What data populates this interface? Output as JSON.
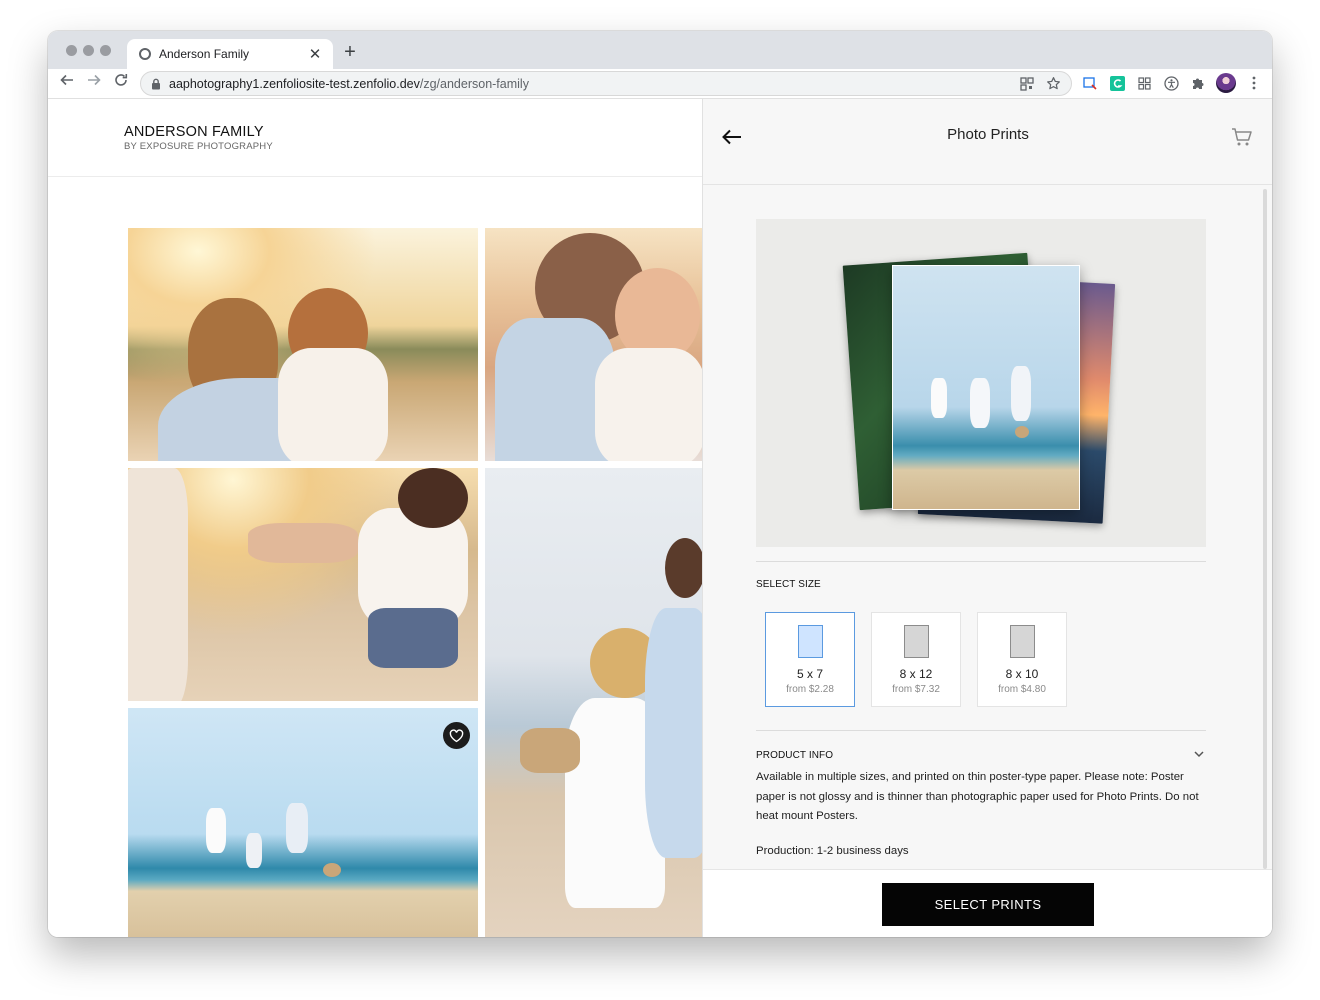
{
  "browser": {
    "tab_title": "Anderson Family",
    "url_host": "aaphotography1.zenfoliosite-test.zenfolio.dev",
    "url_path": "/zg/anderson-family",
    "icons": [
      "lock-icon",
      "qr-code-icon",
      "bookmark-star-icon",
      "reading-list-icon",
      "grammarly-icon",
      "extension-grid-icon",
      "accessibility-icon",
      "puzzle-icon",
      "profile-avatar",
      "kebab-menu-icon"
    ]
  },
  "site": {
    "title": "ANDERSON FAMILY",
    "subtitle": "BY EXPOSURE PHOTOGRAPHY"
  },
  "gallery": {
    "photos": [
      {
        "name": "photo-father-daughter-sunset"
      },
      {
        "name": "photo-father-kissing-daughter"
      },
      {
        "name": "photo-holding-hands-beach"
      },
      {
        "name": "photo-family-smiling-beach"
      },
      {
        "name": "photo-family-walking-shore",
        "favorite_icon": "heart-icon"
      }
    ]
  },
  "panel": {
    "title": "Photo Prints",
    "select_size_label": "SELECT SIZE",
    "sizes": [
      {
        "name": "5 x 7",
        "price": "from $2.28",
        "selected": true
      },
      {
        "name": "8 x 12",
        "price": "from $7.32",
        "selected": false
      },
      {
        "name": "8 x 10",
        "price": "from $4.80",
        "selected": false
      }
    ],
    "product_info_label": "PRODUCT INFO",
    "product_info_text": "Available in multiple sizes, and printed on thin poster-type paper. Please note: Poster paper is not glossy and is thinner than photographic paper used for Photo Prints. Do not heat mount Posters.",
    "production_text": "Production: 1-2 business days",
    "cta_label": "SELECT PRINTS"
  },
  "colors": {
    "selected_border": "#5b9ae0",
    "selected_swatch": "#cfe4ff",
    "cta_background": "#050505"
  }
}
